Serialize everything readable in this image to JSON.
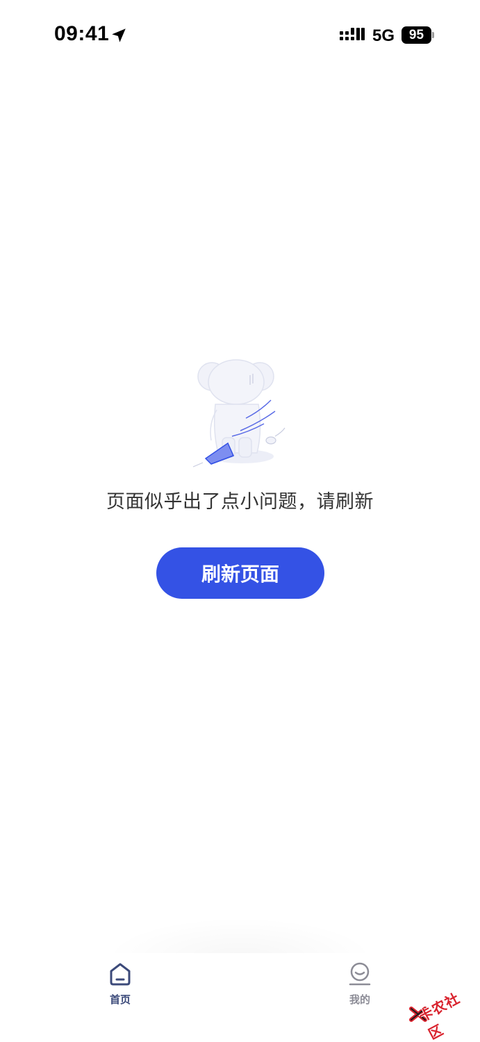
{
  "status_bar": {
    "time": "09:41",
    "network": "5G",
    "battery": "95"
  },
  "error_state": {
    "message": "页面似乎出了点小问题，请刷新",
    "refresh_label": "刷新页面",
    "illustration": "koala-back-illustration"
  },
  "tab_bar": {
    "items": [
      {
        "label": "首页",
        "icon": "home-icon",
        "active": true
      },
      {
        "label": "我的",
        "icon": "profile-icon",
        "active": false
      }
    ]
  },
  "watermark": {
    "text": "卡农社区"
  },
  "colors": {
    "accent": "#3452e5",
    "tab_active": "#3c4a7a",
    "tab_inactive": "#8c8c96",
    "text": "#333333"
  }
}
